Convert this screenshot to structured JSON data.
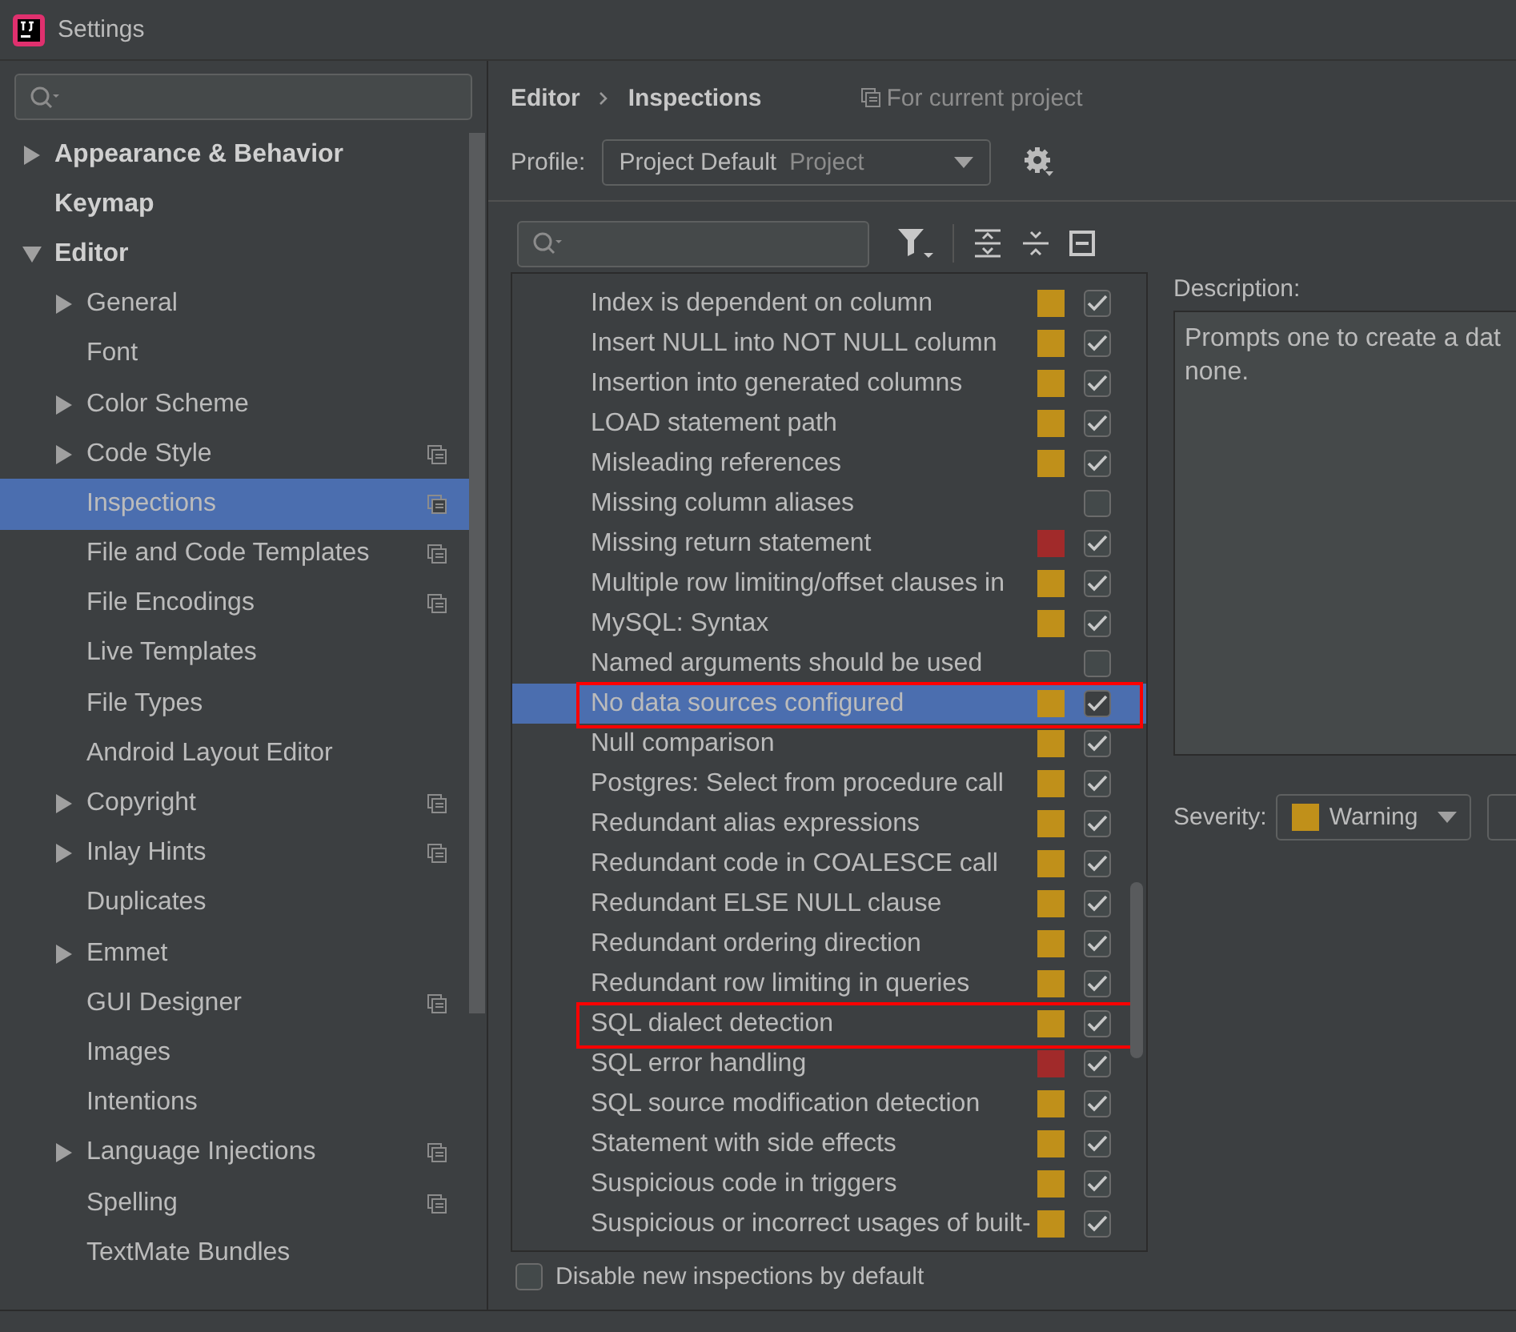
{
  "window": {
    "title": "Settings"
  },
  "sidebar": {
    "items": [
      {
        "label": "Appearance & Behavior",
        "expandable": true,
        "expanded": false,
        "selected": false,
        "project": false
      },
      {
        "label": "Keymap",
        "expandable": false,
        "selected": false,
        "project": false
      },
      {
        "label": "Editor",
        "expandable": true,
        "expanded": true,
        "selected": false,
        "project": false,
        "children": [
          {
            "label": "General",
            "expandable": true,
            "expanded": false,
            "selected": false,
            "project": false
          },
          {
            "label": "Font",
            "expandable": false,
            "selected": false,
            "project": false
          },
          {
            "label": "Color Scheme",
            "expandable": true,
            "expanded": false,
            "selected": false,
            "project": false
          },
          {
            "label": "Code Style",
            "expandable": true,
            "expanded": false,
            "selected": false,
            "project": true
          },
          {
            "label": "Inspections",
            "expandable": false,
            "selected": true,
            "project": true
          },
          {
            "label": "File and Code Templates",
            "expandable": false,
            "selected": false,
            "project": true
          },
          {
            "label": "File Encodings",
            "expandable": false,
            "selected": false,
            "project": true
          },
          {
            "label": "Live Templates",
            "expandable": false,
            "selected": false,
            "project": false
          },
          {
            "label": "File Types",
            "expandable": false,
            "selected": false,
            "project": false
          },
          {
            "label": "Android Layout Editor",
            "expandable": false,
            "selected": false,
            "project": false
          },
          {
            "label": "Copyright",
            "expandable": true,
            "expanded": false,
            "selected": false,
            "project": true
          },
          {
            "label": "Inlay Hints",
            "expandable": true,
            "expanded": false,
            "selected": false,
            "project": true
          },
          {
            "label": "Duplicates",
            "expandable": false,
            "selected": false,
            "project": false
          },
          {
            "label": "Emmet",
            "expandable": true,
            "expanded": false,
            "selected": false,
            "project": false
          },
          {
            "label": "GUI Designer",
            "expandable": false,
            "selected": false,
            "project": true
          },
          {
            "label": "Images",
            "expandable": false,
            "selected": false,
            "project": false
          },
          {
            "label": "Intentions",
            "expandable": false,
            "selected": false,
            "project": false
          },
          {
            "label": "Language Injections",
            "expandable": true,
            "expanded": false,
            "selected": false,
            "project": true
          },
          {
            "label": "Spelling",
            "expandable": false,
            "selected": false,
            "project": true
          },
          {
            "label": "TextMate Bundles",
            "expandable": false,
            "selected": false,
            "project": false
          }
        ]
      }
    ]
  },
  "breadcrumb": [
    "Editor",
    "Inspections"
  ],
  "scope_note": "For current project",
  "profile": {
    "label": "Profile:",
    "name": "Project Default",
    "scope": "Project"
  },
  "inspections": [
    {
      "name": "Index is dependent on column",
      "color": "#c0901a",
      "checked": true,
      "selected": false,
      "highlighted": false
    },
    {
      "name": "Insert NULL into NOT NULL column",
      "color": "#c0901a",
      "checked": true,
      "selected": false,
      "highlighted": false
    },
    {
      "name": "Insertion into generated columns",
      "color": "#c0901a",
      "checked": true,
      "selected": false,
      "highlighted": false
    },
    {
      "name": "LOAD statement path",
      "color": "#c0901a",
      "checked": true,
      "selected": false,
      "highlighted": false
    },
    {
      "name": "Misleading references",
      "color": "#c0901a",
      "checked": true,
      "selected": false,
      "highlighted": false
    },
    {
      "name": "Missing column aliases",
      "checked": false,
      "selected": false,
      "highlighted": false
    },
    {
      "name": "Missing return statement",
      "color": "#a12a2a",
      "checked": true,
      "selected": false,
      "highlighted": false
    },
    {
      "name": "Multiple row limiting/offset clauses in",
      "color": "#c0901a",
      "checked": true,
      "selected": false,
      "highlighted": false
    },
    {
      "name": "MySQL: Syntax",
      "color": "#c0901a",
      "checked": true,
      "selected": false,
      "highlighted": false
    },
    {
      "name": "Named arguments should be used",
      "checked": false,
      "selected": false,
      "highlighted": false
    },
    {
      "name": "No data sources configured",
      "color": "#c0901a",
      "checked": true,
      "selected": true,
      "highlighted": true
    },
    {
      "name": "Null comparison",
      "color": "#c0901a",
      "checked": true,
      "selected": false,
      "highlighted": false
    },
    {
      "name": "Postgres: Select from procedure call",
      "color": "#c0901a",
      "checked": true,
      "selected": false,
      "highlighted": false
    },
    {
      "name": "Redundant alias expressions",
      "color": "#c0901a",
      "checked": true,
      "selected": false,
      "highlighted": false
    },
    {
      "name": "Redundant code in COALESCE call",
      "color": "#c0901a",
      "checked": true,
      "selected": false,
      "highlighted": false
    },
    {
      "name": "Redundant ELSE NULL clause",
      "color": "#c0901a",
      "checked": true,
      "selected": false,
      "highlighted": false
    },
    {
      "name": "Redundant ordering direction",
      "color": "#c0901a",
      "checked": true,
      "selected": false,
      "highlighted": false
    },
    {
      "name": "Redundant row limiting in queries",
      "color": "#c0901a",
      "checked": true,
      "selected": false,
      "highlighted": false
    },
    {
      "name": "SQL dialect detection",
      "color": "#c0901a",
      "checked": true,
      "selected": false,
      "highlighted": true
    },
    {
      "name": "SQL error handling",
      "color": "#a12a2a",
      "checked": true,
      "selected": false,
      "highlighted": false
    },
    {
      "name": "SQL source modification detection",
      "color": "#c0901a",
      "checked": true,
      "selected": false,
      "highlighted": false
    },
    {
      "name": "Statement with side effects",
      "color": "#c0901a",
      "checked": true,
      "selected": false,
      "highlighted": false
    },
    {
      "name": "Suspicious code in triggers",
      "color": "#c0901a",
      "checked": true,
      "selected": false,
      "highlighted": false
    },
    {
      "name": "Suspicious or incorrect usages of built-",
      "color": "#c0901a",
      "checked": true,
      "selected": false,
      "highlighted": false
    }
  ],
  "disable_new": {
    "label": "Disable new inspections by default",
    "checked": false
  },
  "description": {
    "label": "Description:",
    "text": "Prompts one to create a dat\nnone."
  },
  "severity": {
    "label": "Severity:",
    "value": "Warning",
    "color": "#c0901a"
  }
}
